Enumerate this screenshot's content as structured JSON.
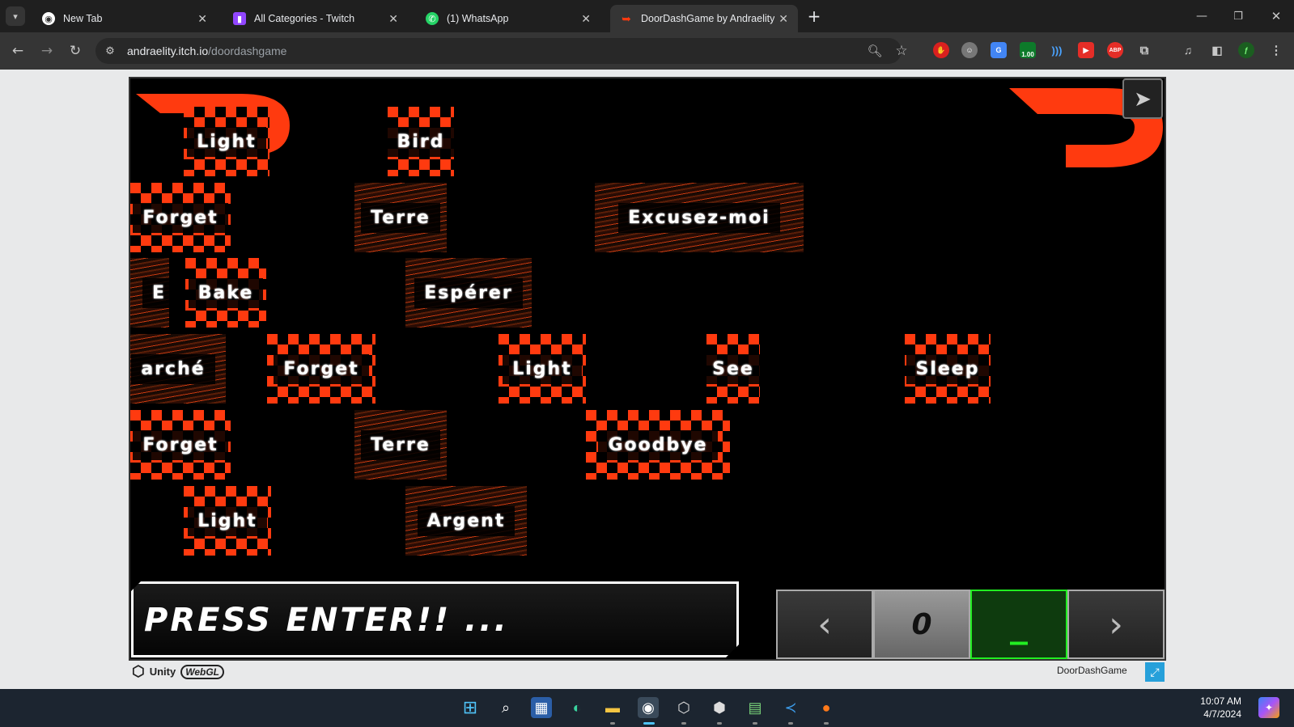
{
  "browser": {
    "tabs": [
      {
        "title": "New Tab",
        "icon": "chrome-icon"
      },
      {
        "title": "All Categories - Twitch",
        "icon": "twitch-icon"
      },
      {
        "title": "(1) WhatsApp",
        "icon": "whatsapp-icon"
      },
      {
        "title": "DoorDashGame by Andraelity",
        "icon": "doordash-icon",
        "active": true
      }
    ],
    "new_tab": "+",
    "url_host": "andraelity.itch.io",
    "url_path": "/doordashgame",
    "extensions": [
      "adblock-hand-icon",
      "avatar-ext-icon",
      "translate-icon",
      "speed-1.00-icon",
      "audio-icon",
      "red-play-icon",
      "abp-icon",
      "puzzle-icon",
      "media-icon",
      "sidepanel-icon",
      "profile-icon",
      "menu-icon"
    ],
    "speed_badge": "1.00",
    "abp_badge": "ABP"
  },
  "game": {
    "words": [
      {
        "text": "Light",
        "style": "check"
      },
      {
        "text": "Bird",
        "style": "check"
      },
      {
        "text": "Forget",
        "style": "check"
      },
      {
        "text": "Terre",
        "style": "streak"
      },
      {
        "text": "Excusez-moi",
        "style": "streak"
      },
      {
        "text": "E",
        "style": "streak"
      },
      {
        "text": "Bake",
        "style": "check"
      },
      {
        "text": "Espérer",
        "style": "streak"
      },
      {
        "text": "arché",
        "style": "streak"
      },
      {
        "text": "Forget",
        "style": "check"
      },
      {
        "text": "Light",
        "style": "check"
      },
      {
        "text": "See",
        "style": "check"
      },
      {
        "text": "Sleep",
        "style": "check"
      },
      {
        "text": "Forget",
        "style": "check"
      },
      {
        "text": "Terre",
        "style": "streak"
      },
      {
        "text": "Goodbye",
        "style": "check"
      },
      {
        "text": "Light",
        "style": "check"
      },
      {
        "text": "Argent",
        "style": "streak"
      }
    ],
    "input_prompt": "PRESS ENTER!! ...",
    "controls": {
      "prev": "‹",
      "score": "0",
      "cursor": "_",
      "next": "›"
    },
    "footer_engine": "Unity",
    "footer_webgl": "WebGL",
    "game_name": "DoorDashGame",
    "accent_color": "#ff3a0f"
  },
  "taskbar": {
    "time": "10:07 AM",
    "date": "4/7/2024",
    "apps": [
      "windows-start-icon",
      "search-icon",
      "store-icon",
      "edge-icon",
      "file-explorer-icon",
      "chrome-icon",
      "unity-hub-icon",
      "unity-icon",
      "notepad-icon",
      "vscode-icon",
      "firefox-icon"
    ]
  }
}
